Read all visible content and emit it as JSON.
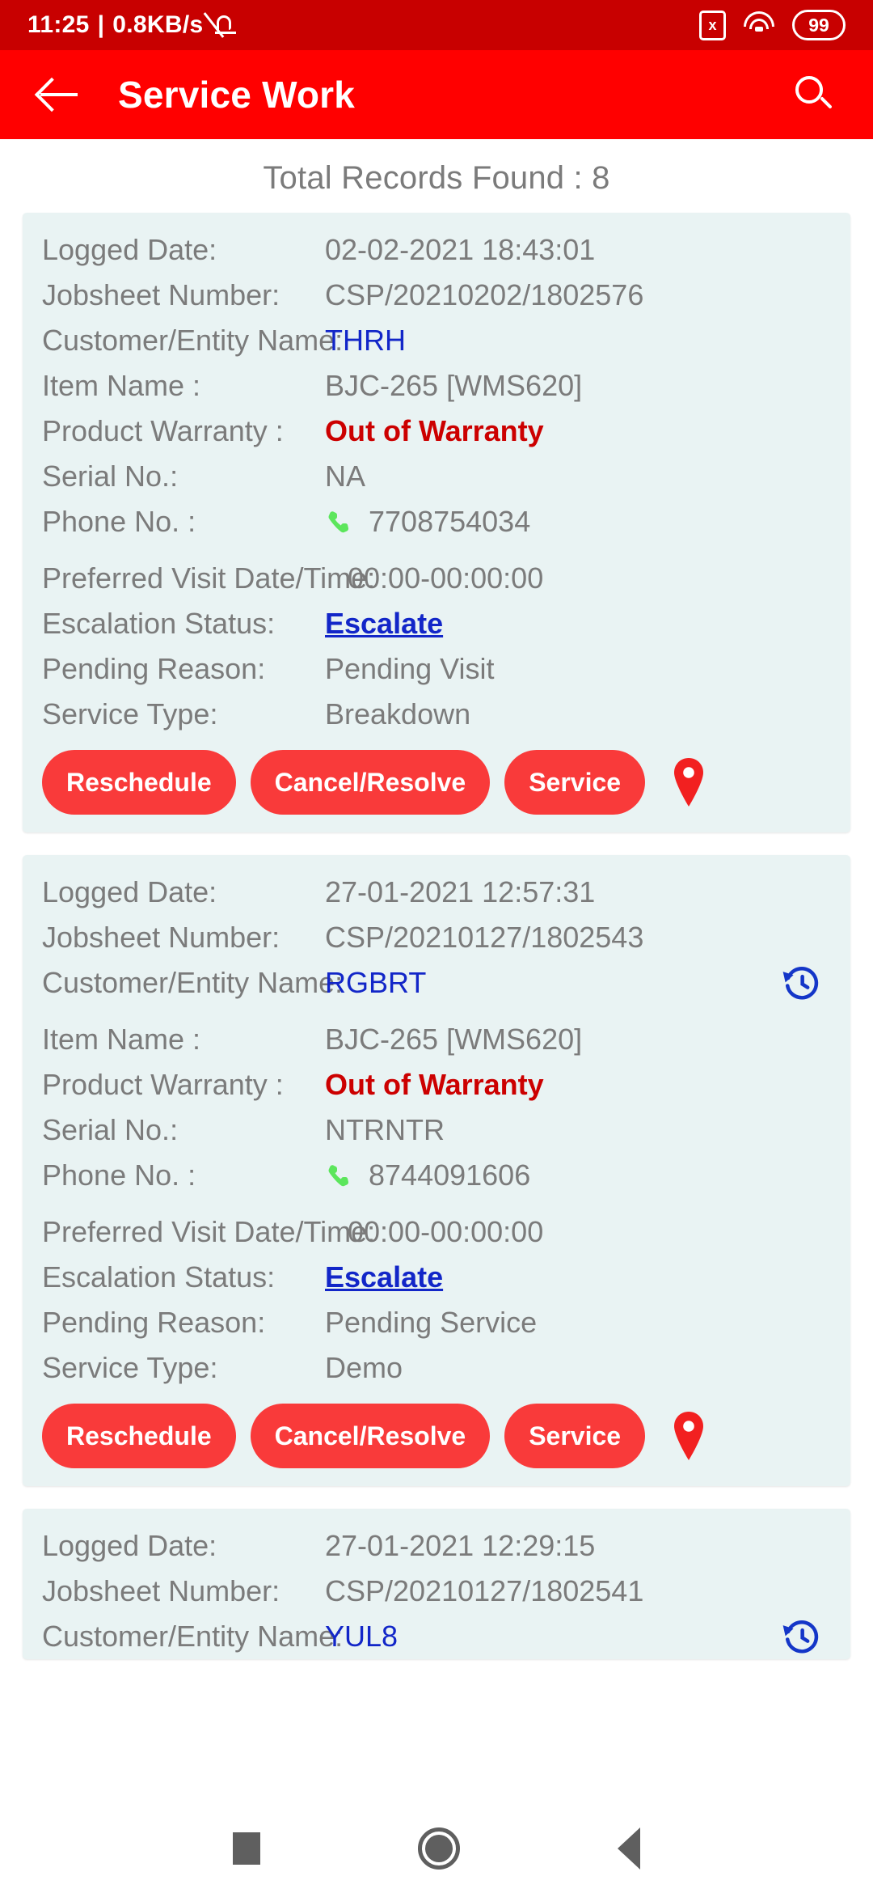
{
  "status_bar": {
    "time": "11:25",
    "separator": "|",
    "network_speed": "0.8KB/s",
    "mute_icon": "bell-mute-icon",
    "sim_icon_label": "x",
    "wifi_icon": "wifi-icon",
    "battery_level": "99"
  },
  "app_bar": {
    "back_icon": "back-arrow-icon",
    "title": "Service Work",
    "search_icon": "search-icon"
  },
  "colors": {
    "status_bar": "#c80000",
    "app_bar": "#ff0000",
    "card_bg": "#e9f3f3",
    "label": "#7b7b7b",
    "link": "#1226c8",
    "warranty": "#cc0000",
    "button": "#f93a3a",
    "phone_green": "#5ce65c"
  },
  "records_header": "Total Records Found : 8",
  "field_labels": {
    "logged_date": "Logged Date:",
    "jobsheet_number": "Jobsheet Number:",
    "customer_name": "Customer/Entity Name:",
    "item_name": "Item Name :",
    "product_warranty": "Product Warranty :",
    "serial_no": "Serial No.:",
    "phone_no": "Phone No. :",
    "preferred_visit": "Preferred Visit Date/Time:",
    "escalation_status": "Escalation Status:",
    "pending_reason": "Pending Reason:",
    "service_type": "Service Type:"
  },
  "buttons": {
    "reschedule": "Reschedule",
    "cancel_resolve": "Cancel/Resolve",
    "service": "Service",
    "map_pin_icon": "map-pin-icon"
  },
  "records": [
    {
      "logged_date": "02-02-2021 18:43:01",
      "jobsheet_number": "CSP/20210202/1802576",
      "customer_name": "THRH",
      "has_history_icon": false,
      "item_name": "BJC-265 [WMS620]",
      "product_warranty": "Out of Warranty",
      "serial_no": "NA",
      "phone_no": "7708754034",
      "preferred_visit": "00:00-00:00:00",
      "escalation_status": "Escalate",
      "pending_reason": "Pending Visit",
      "service_type": "Breakdown"
    },
    {
      "logged_date": "27-01-2021 12:57:31",
      "jobsheet_number": "CSP/20210127/1802543",
      "customer_name": "RGBRT",
      "has_history_icon": true,
      "item_name": "BJC-265 [WMS620]",
      "product_warranty": "Out of Warranty",
      "serial_no": "NTRNTR",
      "phone_no": "8744091606",
      "preferred_visit": "00:00-00:00:00",
      "escalation_status": "Escalate",
      "pending_reason": "Pending Service",
      "service_type": "Demo"
    },
    {
      "logged_date": "27-01-2021 12:29:15",
      "jobsheet_number": "CSP/20210127/1802541",
      "customer_name": "YUL8",
      "has_history_icon": true
    }
  ],
  "nav_bar": {
    "recents_icon": "square-recents-icon",
    "home_icon": "circle-home-icon",
    "back_icon": "triangle-back-icon"
  }
}
